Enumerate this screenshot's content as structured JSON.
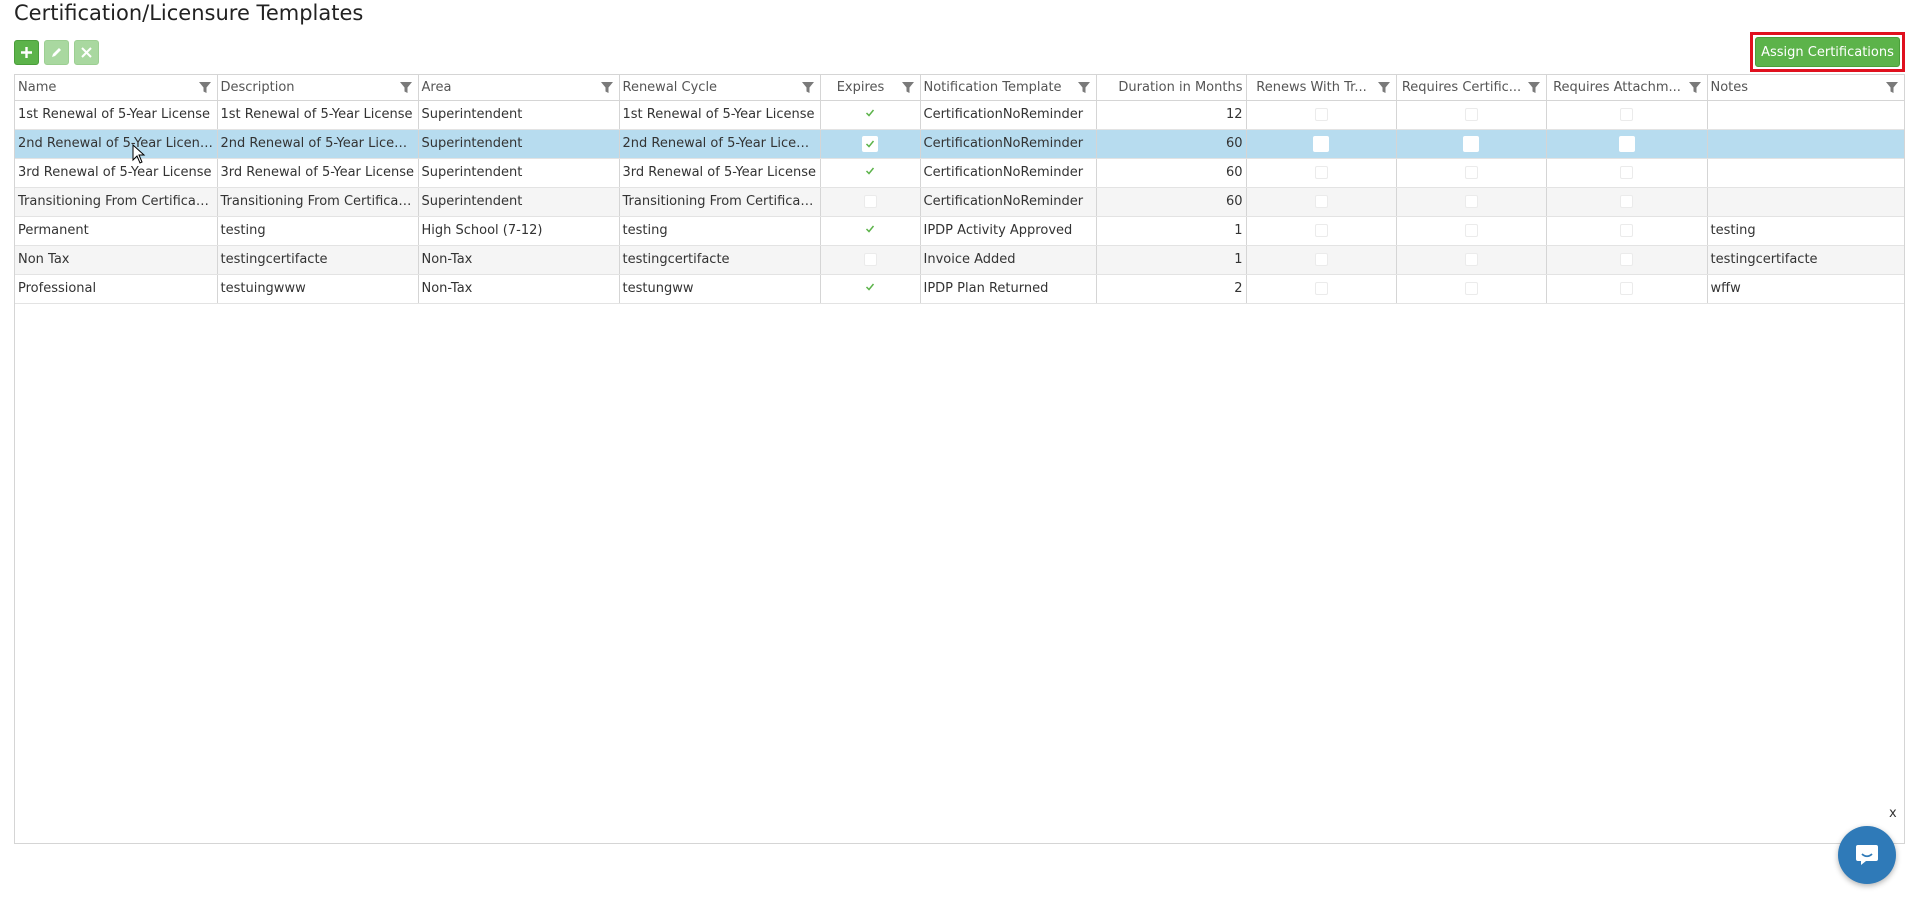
{
  "page": {
    "title": "Certification/Licensure Templates"
  },
  "toolbar": {
    "assign_label": "Assign Certifications"
  },
  "columns": [
    "Name",
    "Description",
    "Area",
    "Renewal Cycle",
    "Expires",
    "Notification Template",
    "Duration in Months",
    "Renews With Tr...",
    "Requires Certific...",
    "Requires Attachm...",
    "Notes"
  ],
  "rows": [
    {
      "name": "1st Renewal of 5-Year License",
      "description": "1st Renewal of 5-Year License",
      "area": "Superintendent",
      "renewal_cycle": "1st Renewal of 5-Year License",
      "expires": true,
      "notification_template": "CertificationNoReminder",
      "duration": "12",
      "notes": ""
    },
    {
      "name": "2nd Renewal of 5-Year License",
      "description": "2nd Renewal of 5-Year License",
      "area": "Superintendent",
      "renewal_cycle": "2nd Renewal of 5-Year License",
      "expires": true,
      "notification_template": "CertificationNoReminder",
      "duration": "60",
      "notes": ""
    },
    {
      "name": "3rd Renewal of 5-Year License",
      "description": "3rd Renewal of 5-Year License",
      "area": "Superintendent",
      "renewal_cycle": "3rd Renewal of 5-Year License",
      "expires": true,
      "notification_template": "CertificationNoReminder",
      "duration": "60",
      "notes": ""
    },
    {
      "name": "Transitioning From Certificate ...",
      "description": "Transitioning From Certificate...",
      "area": "Superintendent",
      "renewal_cycle": "Transitioning From Certificate...",
      "expires": false,
      "notification_template": "CertificationNoReminder",
      "duration": "60",
      "notes": ""
    },
    {
      "name": "Permanent",
      "description": "testing",
      "area": "High School (7-12)",
      "renewal_cycle": "testing",
      "expires": true,
      "notification_template": "IPDP Activity Approved",
      "duration": "1",
      "notes": "testing"
    },
    {
      "name": "Non Tax",
      "description": "testingcertifacte",
      "area": "Non-Tax",
      "renewal_cycle": "testingcertifacte",
      "expires": false,
      "notification_template": "Invoice Added",
      "duration": "1",
      "notes": "testingcertifacte"
    },
    {
      "name": "Professional",
      "description": "testuingwww",
      "area": "Non-Tax",
      "renewal_cycle": "testungww",
      "expires": true,
      "notification_template": "IPDP Plan Returned",
      "duration": "2",
      "notes": "wffw"
    }
  ],
  "chat": {
    "close_label": "x"
  },
  "colors": {
    "accent_green": "#5cb34a",
    "selected_row": "#b7dcef",
    "highlight_border": "#e0101e",
    "chat_blue": "#2f7ab8"
  },
  "icons": [
    "plus-icon",
    "pencil-icon",
    "close-icon",
    "filter-icon",
    "checkmark-icon",
    "chat-icon",
    "mouse-cursor-icon"
  ]
}
